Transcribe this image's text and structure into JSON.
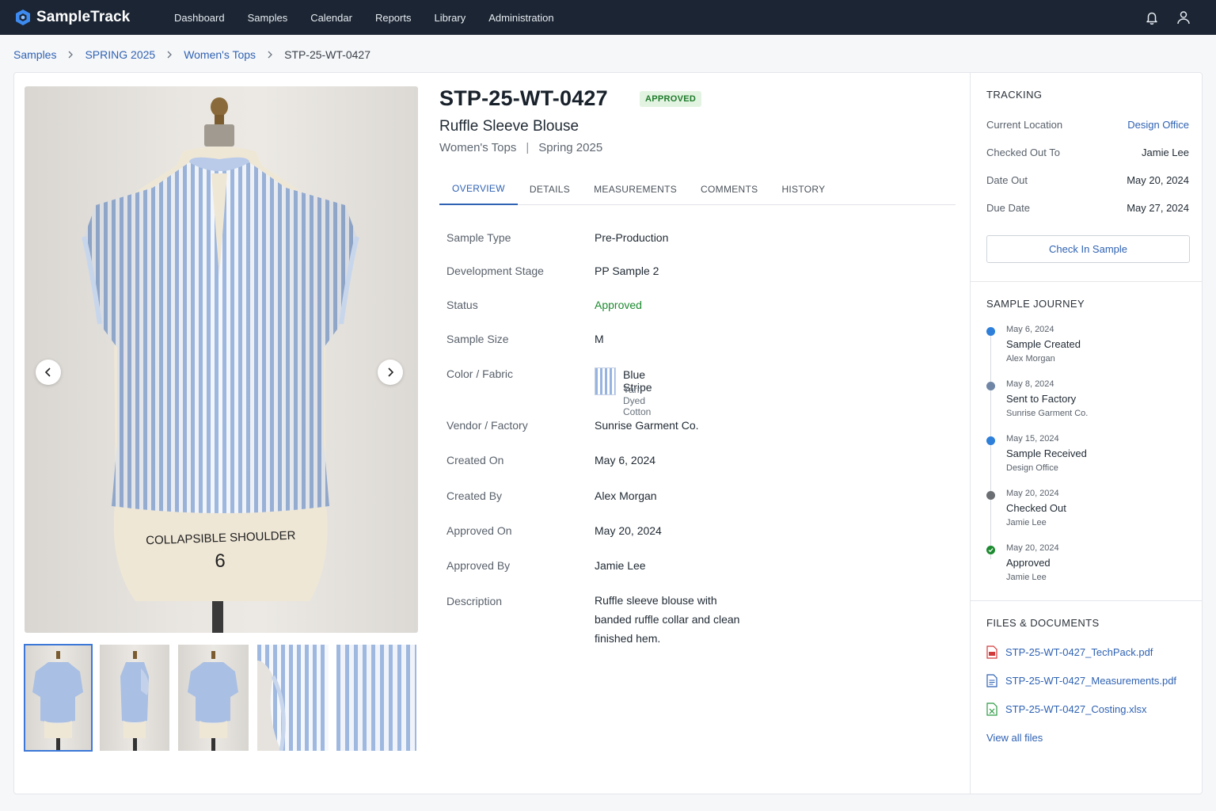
{
  "app": {
    "name": "SampleTrack"
  },
  "nav": {
    "items": [
      {
        "label": "Dashboard"
      },
      {
        "label": "Samples"
      },
      {
        "label": "Calendar"
      },
      {
        "label": "Reports"
      },
      {
        "label": "Library"
      },
      {
        "label": "Administration"
      }
    ]
  },
  "breadcrumb": {
    "items": [
      "Samples",
      "SPRING 2025",
      "Women's Tops"
    ],
    "current": "STP-25-WT-0427"
  },
  "sample": {
    "id": "STP-25-WT-0427",
    "status_badge": "APPROVED",
    "name": "Ruffle Sleeve Blouse",
    "category": "Women's Tops",
    "season": "Spring 2025",
    "dress_form_text": "COLLAPSIBLE SHOULDER",
    "dress_form_size": "6"
  },
  "tabs": [
    {
      "label": "OVERVIEW",
      "active": true
    },
    {
      "label": "DETAILS",
      "active": false
    },
    {
      "label": "MEASUREMENTS",
      "active": false
    },
    {
      "label": "COMMENTS",
      "active": false
    },
    {
      "label": "HISTORY",
      "active": false
    }
  ],
  "overview": {
    "sample_type": {
      "label": "Sample Type",
      "value": "Pre-Production"
    },
    "development_stage": {
      "label": "Development Stage",
      "value": "PP Sample 2"
    },
    "status": {
      "label": "Status",
      "value": "Approved"
    },
    "sample_size": {
      "label": "Sample Size",
      "value": "M"
    },
    "color_fabric": {
      "label": "Color / Fabric",
      "value": "Blue Stripe",
      "sub": "Yarn Dyed Cotton"
    },
    "vendor": {
      "label": "Vendor / Factory",
      "value": "Sunrise Garment Co."
    },
    "created_on": {
      "label": "Created On",
      "value": "May 6, 2024"
    },
    "created_by": {
      "label": "Created By",
      "value": "Alex Morgan"
    },
    "approved_on": {
      "label": "Approved On",
      "value": "May 20, 2024"
    },
    "approved_by": {
      "label": "Approved By",
      "value": "Jamie Lee"
    },
    "description": {
      "label": "Description",
      "value": "Ruffle sleeve blouse with banded ruffle collar and clean finished hem."
    }
  },
  "tracking": {
    "title": "TRACKING",
    "current_location": {
      "label": "Current Location",
      "value": "Design Office"
    },
    "checked_out_to": {
      "label": "Checked Out To",
      "value": "Jamie Lee"
    },
    "date_out": {
      "label": "Date Out",
      "value": "May 20, 2024"
    },
    "due_date": {
      "label": "Due Date",
      "value": "May 27, 2024"
    },
    "check_in_label": "Check In Sample"
  },
  "journey": {
    "title": "SAMPLE JOURNEY",
    "events": [
      {
        "date": "May 6, 2024",
        "event": "Sample Created",
        "who": "Alex Morgan"
      },
      {
        "date": "May 8, 2024",
        "event": "Sent to Factory",
        "who": "Sunrise Garment Co."
      },
      {
        "date": "May 15, 2024",
        "event": "Sample Received",
        "who": "Design Office"
      },
      {
        "date": "May 20, 2024",
        "event": "Checked Out",
        "who": "Jamie Lee"
      },
      {
        "date": "May 20, 2024",
        "event": "Approved",
        "who": "Jamie Lee"
      }
    ]
  },
  "files": {
    "title": "FILES & DOCUMENTS",
    "items": [
      {
        "name": "STP-25-WT-0427_TechPack.pdf",
        "icon": "pdf-file-icon"
      },
      {
        "name": "STP-25-WT-0427_Measurements.pdf",
        "icon": "document-file-icon"
      },
      {
        "name": "STP-25-WT-0427_Costing.xlsx",
        "icon": "spreadsheet-file-icon"
      }
    ],
    "view_all_label": "View all files"
  },
  "colors": {
    "topbar": "#1b2533",
    "accent": "#2f62b3",
    "approved_green": "#1c8a2f",
    "stripe_blue": "#97b4e0"
  }
}
